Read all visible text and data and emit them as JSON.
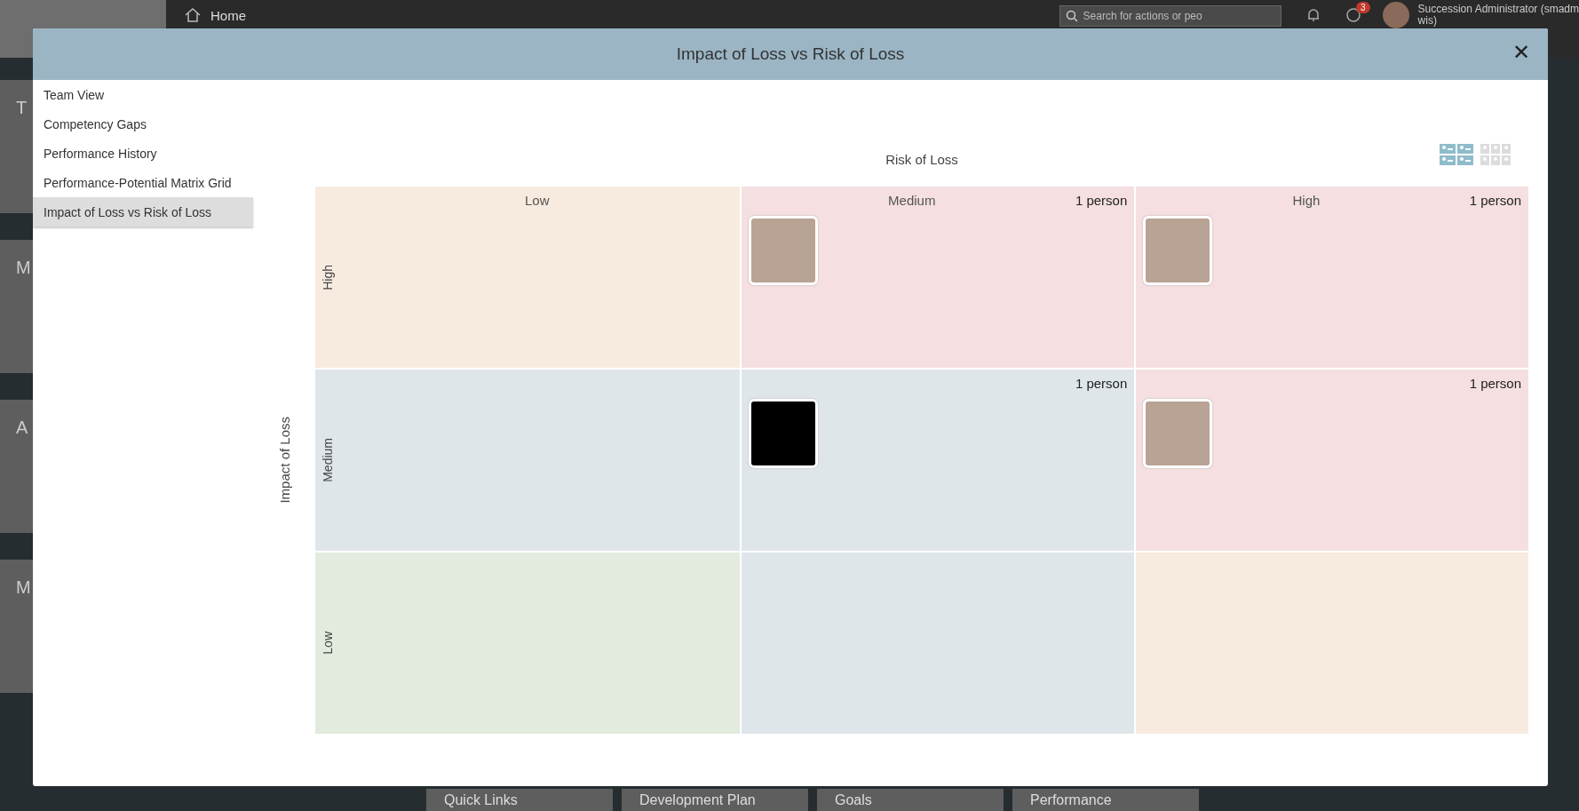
{
  "top_bar": {
    "home": "Home",
    "search": {
      "placeholder": "Search for actions or peo"
    },
    "notifications_badge": "3",
    "user_lines": [
      "Succession Administrator (smadm",
      "wis)"
    ]
  },
  "background_cards": [
    "T",
    "M",
    "A",
    "M"
  ],
  "background_tiles": [
    "Quick Links",
    "Development Plan",
    "Goals",
    "Performance"
  ],
  "dialog": {
    "title": "Impact of Loss vs Risk of Loss",
    "close": "✕",
    "sidebar": {
      "items": [
        {
          "label": "Team View",
          "selected": false
        },
        {
          "label": "Competency Gaps",
          "selected": false
        },
        {
          "label": "Performance History",
          "selected": false
        },
        {
          "label": "Performance-Potential Matrix Grid",
          "selected": false
        },
        {
          "label": "Impact of Loss vs Risk of Loss",
          "selected": true
        }
      ]
    },
    "matrix": {
      "x_axis": "Risk of Loss",
      "y_axis": "Impact of Loss",
      "view_toggles": [
        {
          "kind": "list",
          "selected": true
        },
        {
          "kind": "grid",
          "selected": false
        }
      ],
      "columns": [
        "Low",
        "Medium",
        "High"
      ],
      "rows": [
        {
          "label": "High",
          "cells": [
            {
              "color": "#f7ebdf"
            },
            {
              "color": "#f5dfe0",
              "count": "1 person",
              "photos": [
                {
                  "kind": "photo"
                }
              ]
            },
            {
              "color": "#f5dfe0",
              "count": "1 person",
              "photos": [
                {
                  "kind": "photo"
                }
              ]
            }
          ]
        },
        {
          "label": "Medium",
          "cells": [
            {
              "color": "#dfe6ea"
            },
            {
              "color": "#dfe6ea",
              "count": "1 person",
              "photos": [
                {
                  "kind": "blank"
                }
              ]
            },
            {
              "color": "#f5dfe0",
              "count": "1 person",
              "photos": [
                {
                  "kind": "photo"
                }
              ]
            }
          ]
        },
        {
          "label": "Low",
          "cells": [
            {
              "color": "#e3ebde"
            },
            {
              "color": "#dfe6ea"
            },
            {
              "color": "#f7ebdf"
            }
          ]
        }
      ]
    }
  }
}
